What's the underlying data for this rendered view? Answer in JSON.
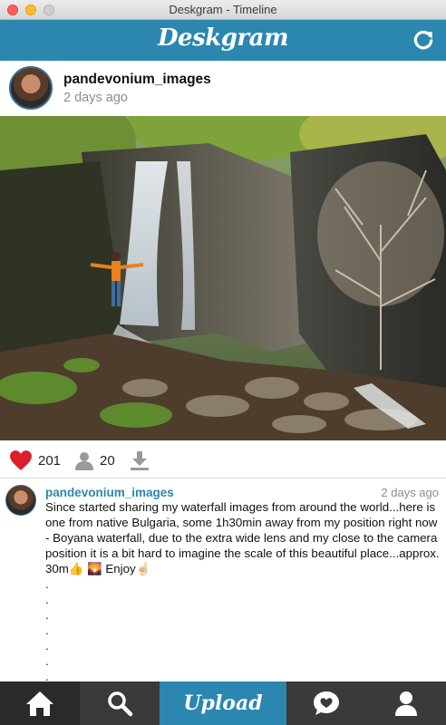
{
  "window": {
    "title": "Deskgram - Timeline"
  },
  "appbar": {
    "brand": "Deskgram",
    "refresh_icon": "refresh-icon"
  },
  "post": {
    "author": "pandevonium_images",
    "time": "2 days ago",
    "photo_icon": "waterfall-photo",
    "likes": "201",
    "comments": "20",
    "icons": {
      "like": "heart-icon",
      "comments": "user-icon",
      "download": "download-icon"
    }
  },
  "comment": {
    "author": "pandevonium_images",
    "time": "2 days ago",
    "text": "Since started sharing my waterfall images from around the world...here is one from native Bulgaria, some 1h30min away from my position right now - Boyana waterfall, due to the extra wide lens and my close to the camera position it is a bit hard to imagine the scale of this beautiful place...approx. 30m👍 🌄 Enjoy☝🏻\n.\n.\n.\n.\n.\n.\n.\n."
  },
  "tabs": {
    "home_icon": "home-icon",
    "search_icon": "search-icon",
    "upload_label": "Upload",
    "activity_icon": "heart-bubble-icon",
    "profile_icon": "profile-icon"
  },
  "colors": {
    "accent": "#2b87b0",
    "tabbar": "#3a3a3a",
    "like": "#d9202b"
  }
}
